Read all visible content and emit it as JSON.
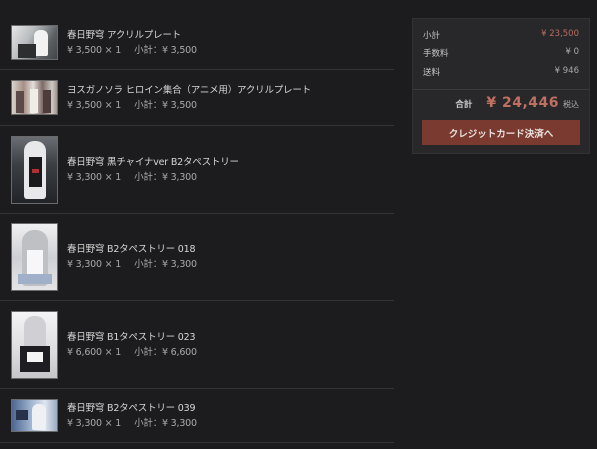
{
  "cart": {
    "items": [
      {
        "title": "春日野穹 アクリルプレート",
        "price": "¥ 3,500 × 1",
        "subtotal": "小計：¥ 3,500"
      },
      {
        "title": "ヨスガノソラ ヒロイン集合（アニメ用）アクリルプレート",
        "price": "¥ 3,500 × 1",
        "subtotal": "小計：¥ 3,500"
      },
      {
        "title": "春日野穹 黒チャイナver B2タペストリー",
        "price": "¥ 3,300 × 1",
        "subtotal": "小計：¥ 3,300"
      },
      {
        "title": "春日野穹 B2タペストリー 018",
        "price": "¥ 3,300 × 1",
        "subtotal": "小計：¥ 3,300"
      },
      {
        "title": "春日野穹 B1タペストリー 023",
        "price": "¥ 6,600 × 1",
        "subtotal": "小計：¥ 6,600"
      },
      {
        "title": "春日野穹 B2タペストリー 039",
        "price": "¥ 3,300 × 1",
        "subtotal": "小計：¥ 3,300"
      }
    ]
  },
  "summary": {
    "subtotal_label": "小計",
    "subtotal_value": "¥ 23,500",
    "fee_label": "手数料",
    "fee_value": "¥ 0",
    "shipping_label": "送料",
    "shipping_value": "¥ 946",
    "total_label": "合計",
    "total_value": "¥ 24,446",
    "total_tax_note": "税込",
    "pay_button_label": "クレジットカード決済へ"
  },
  "colors": {
    "background": "#1c1c1e",
    "panel": "#28282a",
    "accent_text": "#c07060",
    "button": "#7b3a2f"
  }
}
